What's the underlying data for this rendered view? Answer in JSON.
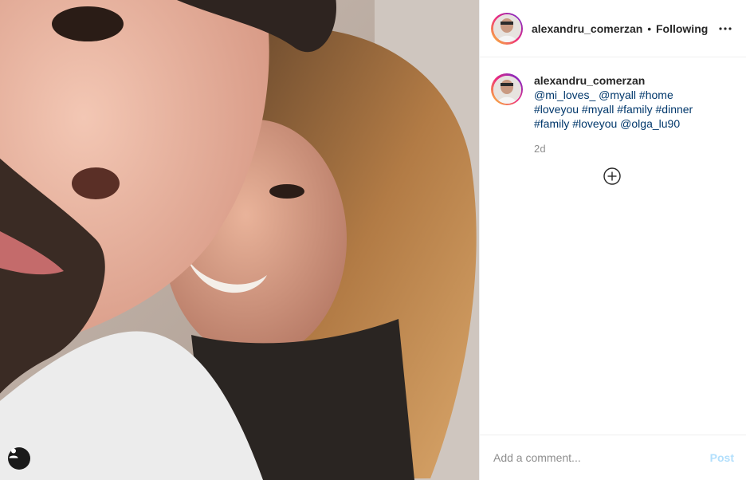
{
  "post": {
    "username": "alexandru_comerzan",
    "separator": "•",
    "follow_status": "Following",
    "more_options_icon": "more-horizontal-icon"
  },
  "caption": {
    "username": "alexandru_comerzan",
    "mentions_line": "@mi_loves_",
    "line2_mention": "@myall",
    "tags_line2": "#home #loveyou #myall",
    "tags_line3": "#family #dinner #family #loveyou",
    "mention_last": "@olga_lu90",
    "timestamp": "2d"
  },
  "comment": {
    "placeholder": "Add a comment...",
    "post_label": "Post"
  },
  "colors": {
    "link": "#00376b",
    "post_disabled": "#b2dffc",
    "muted": "#8e8e8e"
  }
}
